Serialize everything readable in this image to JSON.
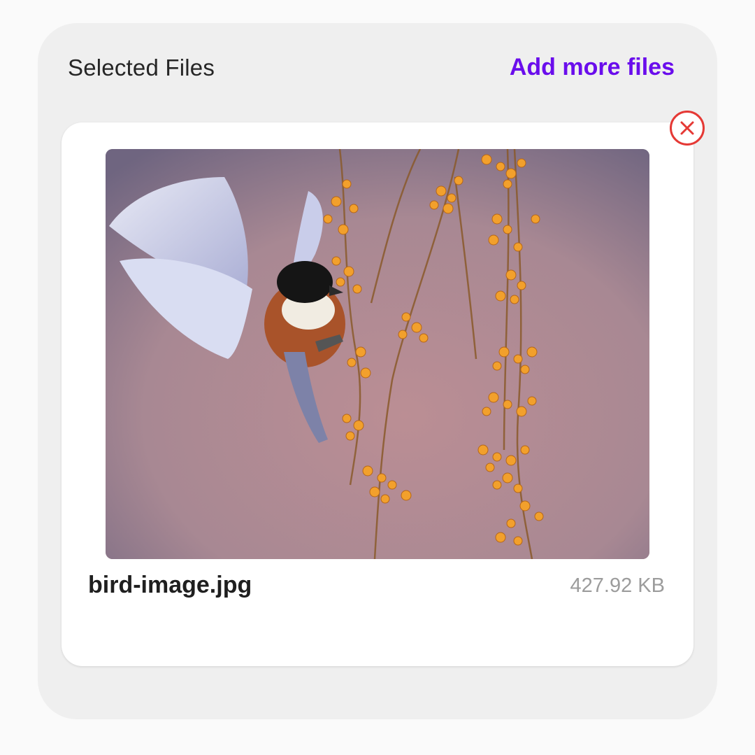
{
  "header": {
    "title": "Selected Files",
    "add_more_label": "Add more files"
  },
  "file": {
    "name": "bird-image.jpg",
    "size": "427.92 KB",
    "thumbnail_icon": "bird-on-berries-photo"
  },
  "remove_icon": "close-circle-icon",
  "colors": {
    "accent": "#6a0dec",
    "remove": "#e53935",
    "panel_bg": "#efefef",
    "card_bg": "#ffffff",
    "size_text": "#9c9c9c"
  }
}
